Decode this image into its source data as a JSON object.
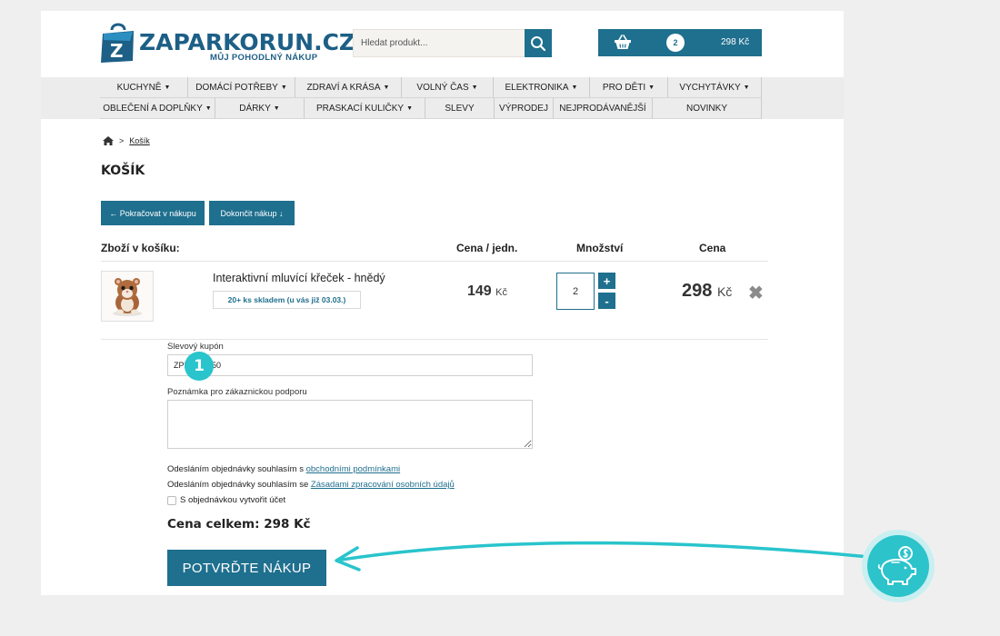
{
  "header": {
    "logo_name": "ZAPARKORUN.CZ",
    "logo_tagline": "MŮJ POHODLNÝ NÁKUP",
    "logo_letter": "Z",
    "search_placeholder": "Hledat produkt...",
    "cart_count": "2",
    "cart_total": "298 Kč"
  },
  "nav": {
    "row1": [
      {
        "label": "KUCHYNĚ",
        "chevron": true
      },
      {
        "label": "DOMÁCÍ POTŘEBY",
        "chevron": true
      },
      {
        "label": "ZDRAVÍ A KRÁSA",
        "chevron": true
      },
      {
        "label": "VOLNÝ ČAS",
        "chevron": true
      },
      {
        "label": "ELEKTRONIKA",
        "chevron": true
      },
      {
        "label": "PRO DĚTI",
        "chevron": true
      },
      {
        "label": "VYCHYTÁVKY",
        "chevron": true
      }
    ],
    "row2": [
      {
        "label": "OBLEČENÍ A DOPLŇKY",
        "chevron": true
      },
      {
        "label": "DÁRKY",
        "chevron": true
      },
      {
        "label": "PRASKACÍ KULIČKY",
        "chevron": true
      },
      {
        "label": "SLEVY",
        "chevron": false
      },
      {
        "label": "VÝPRODEJ",
        "chevron": false
      },
      {
        "label": "NEJPRODÁVANĚJŠÍ",
        "chevron": false
      },
      {
        "label": "NOVINKY",
        "chevron": false
      }
    ]
  },
  "breadcrumb": {
    "sep": ">",
    "current": "Košík"
  },
  "page_title": "KOŠÍK",
  "buttons": {
    "continue": "← Pokračovat v nákupu",
    "finish": "Dokončit nákup ↓"
  },
  "table": {
    "headers": {
      "items": "Zboží v košíku:",
      "unit_price": "Cena / jedn.",
      "quantity": "Množství",
      "price": "Cena"
    },
    "row": {
      "name": "Interaktivní mluvící křeček - hnědý",
      "stock": "20+ ks skladem (u vás již 03.03.)",
      "unit_price": "149",
      "currency": "Kč",
      "quantity": "2",
      "total": "298",
      "plus": "+",
      "minus": "-",
      "remove": "✖"
    }
  },
  "form": {
    "coupon_label": "Slevový kupón",
    "coupon_value": "ZPKAKCE50",
    "note_label": "Poznámka pro zákaznickou podporu",
    "consent1_text": "Odesláním objednávky souhlasím s ",
    "consent1_link": "obchodními podmínkami",
    "consent2_text": "Odesláním objednávky souhlasím se ",
    "consent2_link": "Zásadami zpracování osobních údajů",
    "create_account": "S objednávkou vytvořit účet",
    "grand_total": "Cena celkem: 298 Kč",
    "confirm": "POTVRĎTE NÁKUP"
  },
  "overlay": {
    "step_number": "1"
  },
  "colors": {
    "brand": "#1f6f8e",
    "accent": "#29c4cc",
    "page_bg": "#efefef"
  }
}
